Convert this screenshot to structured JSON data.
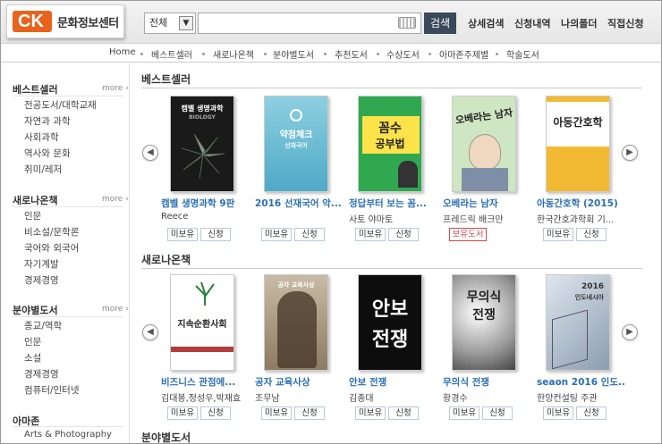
{
  "header": {
    "logo_mark": "CK",
    "logo_text": "문화정보센터",
    "search_select": "전체",
    "search_placeholder": "",
    "search_button": "검색",
    "menu": [
      "상세검색",
      "신청내역",
      "나의폴더",
      "직접신청"
    ]
  },
  "nav": [
    "Home",
    "베스트셀러",
    "새로나온책",
    "분야별도서",
    "추천도서",
    "수상도서",
    "아마존주제별",
    "학술도서"
  ],
  "sidebar": {
    "more_label": "more",
    "sections": [
      {
        "title": "베스트셀러",
        "items": [
          "전공도서/대학교재",
          "자연과 과학",
          "사회과학",
          "역사와 문화",
          "취미/레저"
        ]
      },
      {
        "title": "새로나온책",
        "items": [
          "인문",
          "비소설/문학론",
          "국어와 외국어",
          "자기계발",
          "경제경영"
        ]
      },
      {
        "title": "분야별도서",
        "items": [
          "종교/역학",
          "인문",
          "소설",
          "경제경영",
          "컴퓨터/인터넷"
        ]
      },
      {
        "title": "아마존",
        "items": [
          "Arts & Photography"
        ]
      }
    ]
  },
  "main": {
    "bestsellers": {
      "title": "베스트셀러",
      "books": [
        {
          "title": "캠벨 생명과학 9판",
          "author": "Reece",
          "btn1": "미보유",
          "btn2": "신청",
          "cover_text": "캠벨 생명과학",
          "cover_sub": "BIOLOGY"
        },
        {
          "title": "2016 선재국어 악...",
          "author": "",
          "btn1": "미보유",
          "btn2": "신청",
          "cover_text": "약점체크",
          "cover_sub": "선재국어"
        },
        {
          "title": "정답부터 보는 꼼...",
          "author": "사토 야마토",
          "btn1": "미보유",
          "btn2": "신청",
          "cover_text": "꼼수",
          "cover_sub": "공부법"
        },
        {
          "title": "오베라는 남자",
          "author": "프레드릭 배크만",
          "btn1": "보유도서",
          "btn2": "",
          "cover_text": "오베라는 남자",
          "cover_sub": ""
        },
        {
          "title": "아동간호학 (2015)",
          "author": "한국간호과학회 기...",
          "btn1": "미보유",
          "btn2": "신청",
          "cover_text": "아동간호학",
          "cover_sub": ""
        }
      ]
    },
    "newbooks": {
      "title": "새로나온책",
      "books": [
        {
          "title": "비즈니스 관점에...",
          "author": "김대봉,정성우,박재효",
          "btn1": "미보유",
          "btn2": "신청",
          "cover_text": "지속순환사회",
          "cover_sub": ""
        },
        {
          "title": "공자 교육사상",
          "author": "조무남",
          "btn1": "미보유",
          "btn2": "신청",
          "cover_text": "공자 교육사상",
          "cover_sub": ""
        },
        {
          "title": "안보 전쟁",
          "author": "김종대",
          "btn1": "미보유",
          "btn2": "신청",
          "cover_text": "안보",
          "cover_sub": "전쟁"
        },
        {
          "title": "무의식 전쟁",
          "author": "황경수",
          "btn1": "미보유",
          "btn2": "신청",
          "cover_text": "무의식",
          "cover_sub": "전쟁"
        },
        {
          "title": "seaon 2016 인도...",
          "author": "한양컨설팅 주관",
          "btn1": "미보유",
          "btn2": "신청",
          "cover_text": "2016",
          "cover_sub": "인도네시아"
        }
      ]
    },
    "third_section": {
      "title": "분야별도서"
    }
  },
  "colors": {
    "accent": "#e8641c",
    "link": "#2a6fb5",
    "search_btn": "#3b4a5a",
    "owned": "#d04848"
  }
}
